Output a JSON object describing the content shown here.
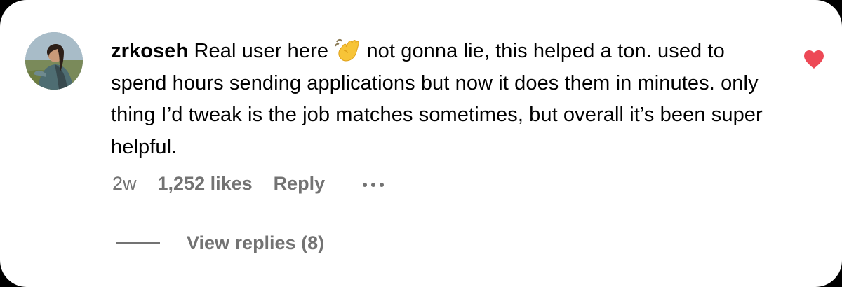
{
  "comment": {
    "avatar_icon": "avatar-photo",
    "username": "zrkoseh",
    "text_before_emoji": "Real user here",
    "emoji": "waving-hand-emoji",
    "text_after_emoji": "not gonna lie, this helped a ton. used to spend hours sending applications but now it does them in minutes. only thing I’d tweak is the job matches sometimes, but overall it’s been super helpful.",
    "time_ago": "2w",
    "likes": "1,252 likes",
    "reply_label": "Reply",
    "more_icon": "more-dots-icon",
    "liked": true,
    "like_icon": "heart-filled-icon",
    "like_color": "#ed4956"
  },
  "replies": {
    "label": "View replies (8)"
  },
  "colors": {
    "card_background": "#ffffff",
    "text_primary": "#000000",
    "text_secondary": "#737373",
    "outer_background": "#000000"
  }
}
